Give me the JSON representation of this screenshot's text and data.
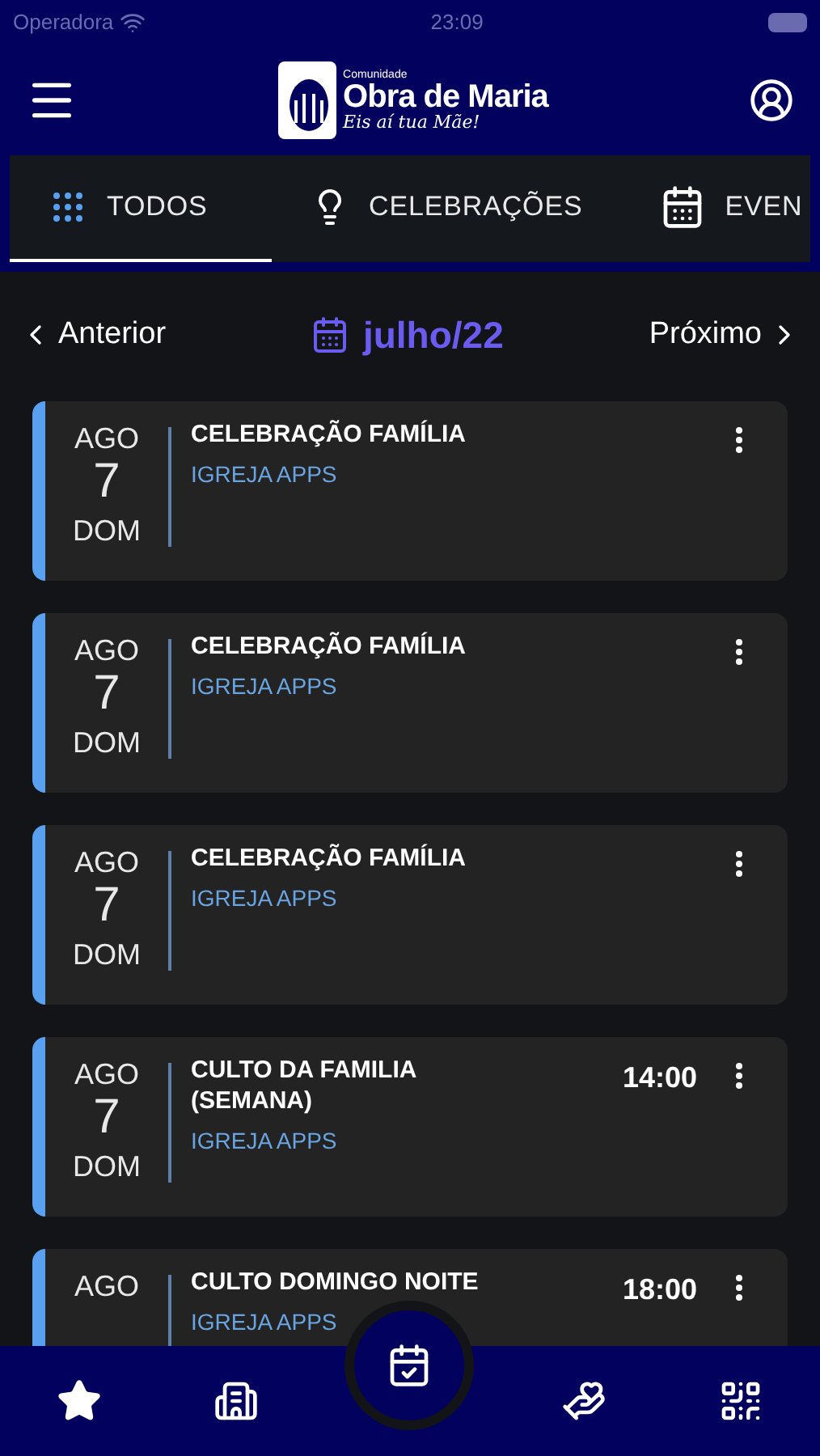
{
  "status_bar": {
    "carrier": "Operadora",
    "time": "23:09"
  },
  "header": {
    "logo_top": "Comunidade",
    "logo_main": "Obra de Maria",
    "logo_tagline": "Eis aí tua Mãe!"
  },
  "tabs": [
    {
      "label": "TODOS",
      "kind": "grid",
      "selected": true
    },
    {
      "label": "CELEBRAÇÕES",
      "kind": "bulb",
      "selected": false
    },
    {
      "label": "EVEN",
      "kind": "calendar",
      "selected": false
    }
  ],
  "month_nav": {
    "previous": "Anterior",
    "month": "julho/22",
    "next": "Próximo"
  },
  "events": [
    {
      "month": "AGO",
      "day": "7",
      "weekday": "DOM",
      "title": "CELEBRAÇÃO FAMÍLIA",
      "church": "IGREJA APPS"
    },
    {
      "month": "AGO",
      "day": "7",
      "weekday": "DOM",
      "title": "CELEBRAÇÃO FAMÍLIA",
      "church": "IGREJA APPS"
    },
    {
      "month": "AGO",
      "day": "7",
      "weekday": "DOM",
      "title": "CELEBRAÇÃO FAMÍLIA",
      "church": "IGREJA APPS"
    },
    {
      "month": "AGO",
      "day": "7",
      "weekday": "DOM",
      "title": "CULTO DA FAMILIA (SEMANA)",
      "church": "IGREJA APPS",
      "time": "14:00"
    },
    {
      "month": "AGO",
      "title": "CULTO DOMINGO NOITE",
      "church": "IGREJA APPS",
      "time": "18:00"
    }
  ],
  "bottom_nav": [
    {
      "kind": "star",
      "selected": false
    },
    {
      "kind": "building",
      "selected": false
    },
    {
      "kind": "calendar",
      "selected": true
    },
    {
      "kind": "donate",
      "selected": false
    },
    {
      "kind": "qr",
      "selected": false
    }
  ]
}
